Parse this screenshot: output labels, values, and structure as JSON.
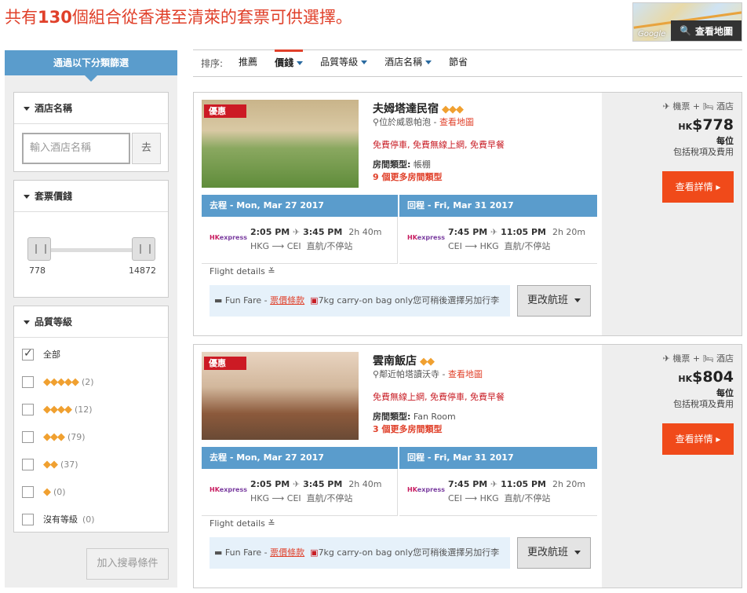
{
  "header": {
    "prefix": "共有",
    "count": "130",
    "suffix": "個組合從香港至清萊的套票可供選擇。"
  },
  "map": {
    "label": "查看地圖",
    "brand": "Google"
  },
  "sidebar": {
    "title": "通過以下分類篩選",
    "hotel_name": {
      "title": "酒店名稱",
      "placeholder": "輸入酒店名稱",
      "go": "去"
    },
    "price": {
      "title": "套票價錢",
      "min": "778",
      "max": "14872"
    },
    "star": {
      "title": "品質等級",
      "options": [
        {
          "label": "全部",
          "diamonds": "",
          "count": "",
          "checked": true
        },
        {
          "label": "",
          "diamonds": "◆◆◆◆◆",
          "count": "(2)",
          "checked": false
        },
        {
          "label": "",
          "diamonds": "◆◆◆◆",
          "count": "(12)",
          "checked": false
        },
        {
          "label": "",
          "diamonds": "◆◆◆",
          "count": "(79)",
          "checked": false
        },
        {
          "label": "",
          "diamonds": "◆◆",
          "count": "(37)",
          "checked": false
        },
        {
          "label": "",
          "diamonds": "◆",
          "count": "(0)",
          "checked": false
        },
        {
          "label": "沒有等級",
          "diamonds": "",
          "count": "(0)",
          "checked": false
        }
      ]
    },
    "add_criteria": "加入搜尋條件"
  },
  "sort": {
    "label": "排序:",
    "items": [
      "推薦",
      "價錢",
      "品質等級",
      "酒店名稱",
      "節省"
    ],
    "active": "價錢"
  },
  "results": [
    {
      "tag": "優惠",
      "hotel": "夫姆塔達民宿",
      "diamonds": "◆◆◆",
      "location": "位於威恩帕泡",
      "map_link": "查看地圖",
      "amenities": "免費停車, 免費無線上網, 免費早餐",
      "room_label": "房間類型:",
      "room_type": "帳棚",
      "more_rooms": "9 個更多房間類型",
      "outbound": {
        "header": "去程 - Mon, Mar 27 2017",
        "airline": "HKexpress",
        "dep": "2:05 PM",
        "arr": "3:45 PM",
        "dur": "2h 40m",
        "route": "HKG ⟶ CEI",
        "stops": "直航/不停站"
      },
      "return": {
        "header": "回程 - Fri, Mar 31 2017",
        "airline": "HKexpress",
        "dep": "7:45 PM",
        "arr": "11:05 PM",
        "dur": "2h 20m",
        "route": "CEI ⟶ HKG",
        "stops": "直航/不停站"
      },
      "flight_details": "Flight details ≚",
      "fare": {
        "name": "Fun Fare",
        "link": "票價條款",
        "bag": "7kg carry-on bag only",
        "note": "您可稍後選擇另加行李"
      },
      "change_flight": "更改航班",
      "package": "✈ 機票 + 🛏 酒店",
      "currency": "HK",
      "price": "$778",
      "per": "每位",
      "incl": "包括稅項及費用",
      "detail": "查看詳情 ▸"
    },
    {
      "tag": "優惠",
      "hotel": "雲南飯店",
      "diamonds": "◆◆",
      "location": "鄰近帕塔讀沃寺",
      "map_link": "查看地圖",
      "amenities": "免費無線上網, 免費停車, 免費早餐",
      "room_label": "房間類型:",
      "room_type": "Fan Room",
      "more_rooms": "3 個更多房間類型",
      "outbound": {
        "header": "去程 - Mon, Mar 27 2017",
        "airline": "HKexpress",
        "dep": "2:05 PM",
        "arr": "3:45 PM",
        "dur": "2h 40m",
        "route": "HKG ⟶ CEI",
        "stops": "直航/不停站"
      },
      "return": {
        "header": "回程 - Fri, Mar 31 2017",
        "airline": "HKexpress",
        "dep": "7:45 PM",
        "arr": "11:05 PM",
        "dur": "2h 20m",
        "route": "CEI ⟶ HKG",
        "stops": "直航/不停站"
      },
      "flight_details": "Flight details ≚",
      "fare": {
        "name": "Fun Fare",
        "link": "票價條款",
        "bag": "7kg carry-on bag only",
        "note": "您可稍後選擇另加行李"
      },
      "change_flight": "更改航班",
      "package": "✈ 機票 + 🛏 酒店",
      "currency": "HK",
      "price": "$804",
      "per": "每位",
      "incl": "包括稅項及費用",
      "detail": "查看詳情 ▸"
    }
  ],
  "colors": {
    "accent": "#e0402a",
    "header_blue": "#5a9ccc",
    "deal_red": "#cc1a24",
    "button_orange": "#f04a1a"
  }
}
